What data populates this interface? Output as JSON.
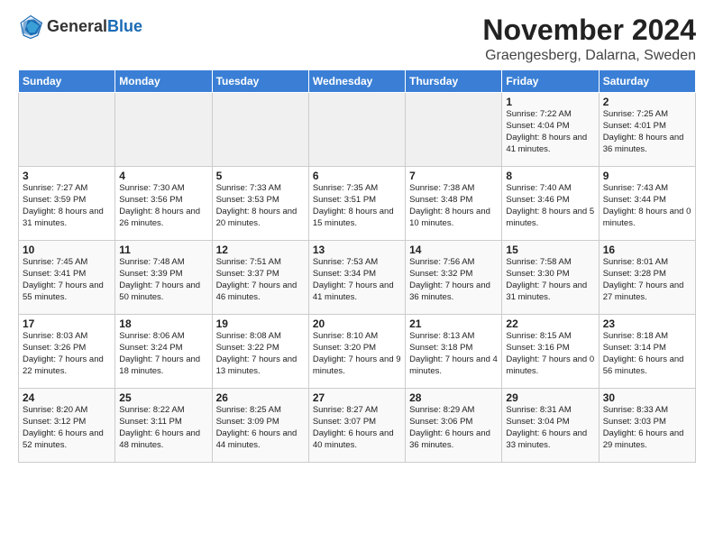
{
  "logo": {
    "general": "General",
    "blue": "Blue"
  },
  "header": {
    "month": "November 2024",
    "location": "Graengesberg, Dalarna, Sweden"
  },
  "weekdays": [
    "Sunday",
    "Monday",
    "Tuesday",
    "Wednesday",
    "Thursday",
    "Friday",
    "Saturday"
  ],
  "weeks": [
    [
      {
        "day": "",
        "info": ""
      },
      {
        "day": "",
        "info": ""
      },
      {
        "day": "",
        "info": ""
      },
      {
        "day": "",
        "info": ""
      },
      {
        "day": "",
        "info": ""
      },
      {
        "day": "1",
        "info": "Sunrise: 7:22 AM\nSunset: 4:04 PM\nDaylight: 8 hours and 41 minutes."
      },
      {
        "day": "2",
        "info": "Sunrise: 7:25 AM\nSunset: 4:01 PM\nDaylight: 8 hours and 36 minutes."
      }
    ],
    [
      {
        "day": "3",
        "info": "Sunrise: 7:27 AM\nSunset: 3:59 PM\nDaylight: 8 hours and 31 minutes."
      },
      {
        "day": "4",
        "info": "Sunrise: 7:30 AM\nSunset: 3:56 PM\nDaylight: 8 hours and 26 minutes."
      },
      {
        "day": "5",
        "info": "Sunrise: 7:33 AM\nSunset: 3:53 PM\nDaylight: 8 hours and 20 minutes."
      },
      {
        "day": "6",
        "info": "Sunrise: 7:35 AM\nSunset: 3:51 PM\nDaylight: 8 hours and 15 minutes."
      },
      {
        "day": "7",
        "info": "Sunrise: 7:38 AM\nSunset: 3:48 PM\nDaylight: 8 hours and 10 minutes."
      },
      {
        "day": "8",
        "info": "Sunrise: 7:40 AM\nSunset: 3:46 PM\nDaylight: 8 hours and 5 minutes."
      },
      {
        "day": "9",
        "info": "Sunrise: 7:43 AM\nSunset: 3:44 PM\nDaylight: 8 hours and 0 minutes."
      }
    ],
    [
      {
        "day": "10",
        "info": "Sunrise: 7:45 AM\nSunset: 3:41 PM\nDaylight: 7 hours and 55 minutes."
      },
      {
        "day": "11",
        "info": "Sunrise: 7:48 AM\nSunset: 3:39 PM\nDaylight: 7 hours and 50 minutes."
      },
      {
        "day": "12",
        "info": "Sunrise: 7:51 AM\nSunset: 3:37 PM\nDaylight: 7 hours and 46 minutes."
      },
      {
        "day": "13",
        "info": "Sunrise: 7:53 AM\nSunset: 3:34 PM\nDaylight: 7 hours and 41 minutes."
      },
      {
        "day": "14",
        "info": "Sunrise: 7:56 AM\nSunset: 3:32 PM\nDaylight: 7 hours and 36 minutes."
      },
      {
        "day": "15",
        "info": "Sunrise: 7:58 AM\nSunset: 3:30 PM\nDaylight: 7 hours and 31 minutes."
      },
      {
        "day": "16",
        "info": "Sunrise: 8:01 AM\nSunset: 3:28 PM\nDaylight: 7 hours and 27 minutes."
      }
    ],
    [
      {
        "day": "17",
        "info": "Sunrise: 8:03 AM\nSunset: 3:26 PM\nDaylight: 7 hours and 22 minutes."
      },
      {
        "day": "18",
        "info": "Sunrise: 8:06 AM\nSunset: 3:24 PM\nDaylight: 7 hours and 18 minutes."
      },
      {
        "day": "19",
        "info": "Sunrise: 8:08 AM\nSunset: 3:22 PM\nDaylight: 7 hours and 13 minutes."
      },
      {
        "day": "20",
        "info": "Sunrise: 8:10 AM\nSunset: 3:20 PM\nDaylight: 7 hours and 9 minutes."
      },
      {
        "day": "21",
        "info": "Sunrise: 8:13 AM\nSunset: 3:18 PM\nDaylight: 7 hours and 4 minutes."
      },
      {
        "day": "22",
        "info": "Sunrise: 8:15 AM\nSunset: 3:16 PM\nDaylight: 7 hours and 0 minutes."
      },
      {
        "day": "23",
        "info": "Sunrise: 8:18 AM\nSunset: 3:14 PM\nDaylight: 6 hours and 56 minutes."
      }
    ],
    [
      {
        "day": "24",
        "info": "Sunrise: 8:20 AM\nSunset: 3:12 PM\nDaylight: 6 hours and 52 minutes."
      },
      {
        "day": "25",
        "info": "Sunrise: 8:22 AM\nSunset: 3:11 PM\nDaylight: 6 hours and 48 minutes."
      },
      {
        "day": "26",
        "info": "Sunrise: 8:25 AM\nSunset: 3:09 PM\nDaylight: 6 hours and 44 minutes."
      },
      {
        "day": "27",
        "info": "Sunrise: 8:27 AM\nSunset: 3:07 PM\nDaylight: 6 hours and 40 minutes."
      },
      {
        "day": "28",
        "info": "Sunrise: 8:29 AM\nSunset: 3:06 PM\nDaylight: 6 hours and 36 minutes."
      },
      {
        "day": "29",
        "info": "Sunrise: 8:31 AM\nSunset: 3:04 PM\nDaylight: 6 hours and 33 minutes."
      },
      {
        "day": "30",
        "info": "Sunrise: 8:33 AM\nSunset: 3:03 PM\nDaylight: 6 hours and 29 minutes."
      }
    ]
  ]
}
